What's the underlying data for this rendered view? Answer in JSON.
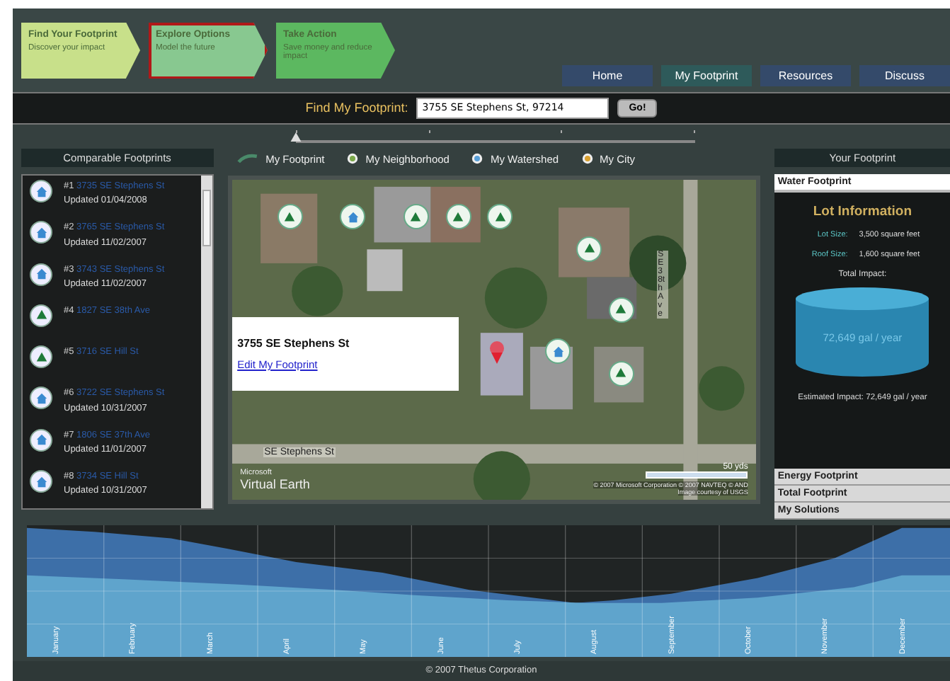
{
  "steps": [
    {
      "title": "Find Your Footprint",
      "subtitle": "Discover your impact",
      "selected": false
    },
    {
      "title": "Explore  Options",
      "subtitle": "Model the future",
      "selected": true
    },
    {
      "title": "Take Action",
      "subtitle": "Save money and reduce impact",
      "selected": false
    }
  ],
  "nav": [
    {
      "label": "Home",
      "selected": false
    },
    {
      "label": "My Footprint",
      "selected": true
    },
    {
      "label": "Resources",
      "selected": false
    },
    {
      "label": "Discuss",
      "selected": false
    }
  ],
  "search": {
    "label": "Find My Footprint:",
    "value": "3755 SE Stephens St, 97214",
    "button": "Go!"
  },
  "scale_slider": {
    "level": 0
  },
  "layers": [
    {
      "label": "My Footprint",
      "kind": "footprint"
    },
    {
      "label": "My Neighborhood",
      "kind": "neighborhood"
    },
    {
      "label": "My Watershed",
      "kind": "watershed"
    },
    {
      "label": "My City",
      "kind": "city"
    }
  ],
  "comparable": {
    "title": "Comparable Footprints",
    "items": [
      {
        "rank": "#1",
        "address": "3735 SE Stephens St",
        "updated": "Updated 01/04/2008",
        "kind": "house"
      },
      {
        "rank": "#2",
        "address": "3765 SE Stephens St",
        "updated": "Updated 11/02/2007",
        "kind": "house"
      },
      {
        "rank": "#3",
        "address": "3743 SE Stephens St",
        "updated": "Updated 11/02/2007",
        "kind": "house"
      },
      {
        "rank": "#4",
        "address": "1827 SE 38th Ave",
        "kind": "tree"
      },
      {
        "rank": "#5",
        "address": "3716 SE Hill St",
        "kind": "tree"
      },
      {
        "rank": "#6",
        "address": "3722 SE Stephens St",
        "updated": "Updated 10/31/2007",
        "kind": "house"
      },
      {
        "rank": "#7",
        "address": "1806 SE 37th Ave",
        "updated": "Updated 11/01/2007",
        "kind": "house"
      },
      {
        "rank": "#8",
        "address": "3734 SE Hill St",
        "updated": "Updated 10/31/2007",
        "kind": "house"
      }
    ]
  },
  "map": {
    "street_labels": [
      "SE Stephens St",
      "SE 38th Ave"
    ],
    "brand": "Microsoft",
    "brand_name": "Virtual Earth",
    "scale": "50 yds",
    "copyright": "© 2007 Microsoft Corporation   © 2007 NAVTEQ   © AND",
    "imagery": "Image courtesy of USGS",
    "popup": {
      "address": "3755 SE Stephens St",
      "link": "Edit My Footprint"
    },
    "markers": [
      {
        "kind": "tree"
      },
      {
        "kind": "house"
      },
      {
        "kind": "tree"
      },
      {
        "kind": "tree"
      },
      {
        "kind": "tree"
      },
      {
        "kind": "tree"
      },
      {
        "kind": "tree"
      },
      {
        "kind": "house"
      },
      {
        "kind": "tree"
      },
      {
        "kind": "pin"
      }
    ]
  },
  "your_footprint": {
    "title": "Your Footprint",
    "sections": [
      {
        "title": "Water Footprint",
        "expanded": true
      },
      {
        "title": "Energy Footprint",
        "expanded": false
      },
      {
        "title": "Total Footprint",
        "expanded": false
      },
      {
        "title": "My Solutions",
        "expanded": false
      }
    ],
    "heading": "Lot Information",
    "facts": [
      {
        "label": "Lot Size:",
        "value": "3,500 square feet"
      },
      {
        "label": "Roof Size:",
        "value": "1,600 square feet"
      }
    ],
    "total_label": "Total Impact:",
    "tank_value": "72,649 gal / year",
    "estimate": "Estimated Impact:  72,649 gal / year"
  },
  "chart": {
    "months": [
      "January",
      "February",
      "March",
      "April",
      "May",
      "June",
      "July",
      "August",
      "September",
      "October",
      "November",
      "December"
    ]
  },
  "footer": "© 2007 Thetus Corporation"
}
